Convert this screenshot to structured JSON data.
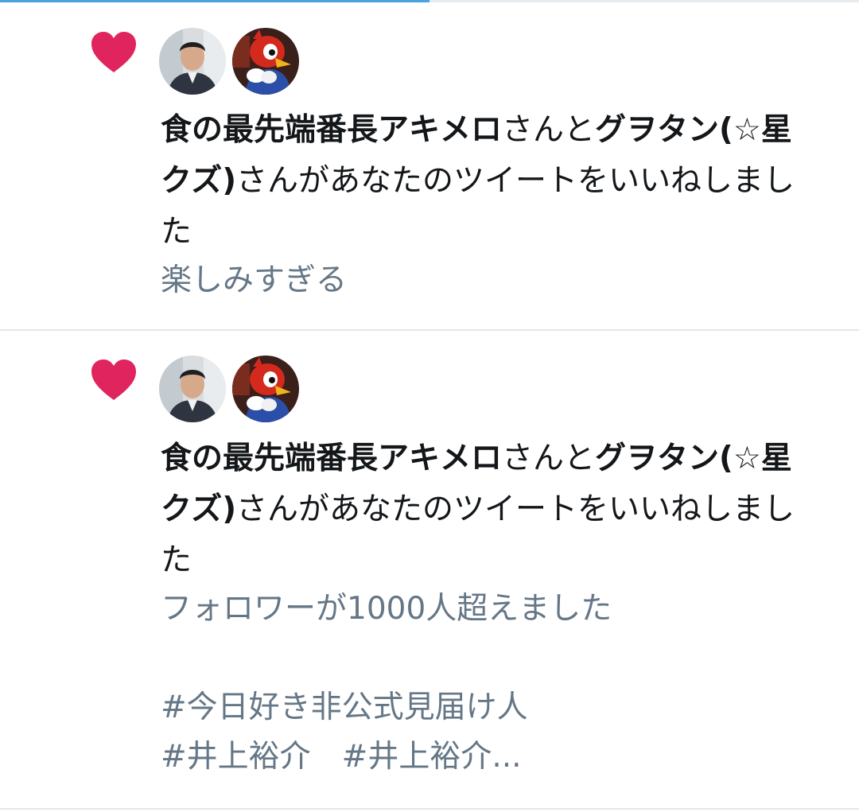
{
  "colors": {
    "heart": "#e0245e",
    "primary_text": "#14171a",
    "secondary_text": "#657786",
    "divider": "#e1e8ed",
    "progress": "#4aa3df"
  },
  "progress": {
    "fraction": 0.5
  },
  "notifications": [
    {
      "icon": "heart-icon",
      "avatars": [
        "person-avatar",
        "bird-mascot-avatar"
      ],
      "user1": "食の最先端番長アキメロ",
      "joiner": "さんと",
      "user2": "グヲタン(☆星クズ)",
      "action": "さんがあなたのツイートをいいねしました",
      "tweet_lines": [
        "楽しみすぎる"
      ]
    },
    {
      "icon": "heart-icon",
      "avatars": [
        "person-avatar",
        "bird-mascot-avatar"
      ],
      "user1": "食の最先端番長アキメロ",
      "joiner": "さんと",
      "user2": "グヲタン(☆星クズ)",
      "action": "さんがあなたのツイートをいいねしました",
      "tweet_lines": [
        "フォロワーが1000人超えました",
        "",
        "#今日好き非公式見届け人",
        "#井上裕介　#井上裕介..."
      ]
    }
  ]
}
